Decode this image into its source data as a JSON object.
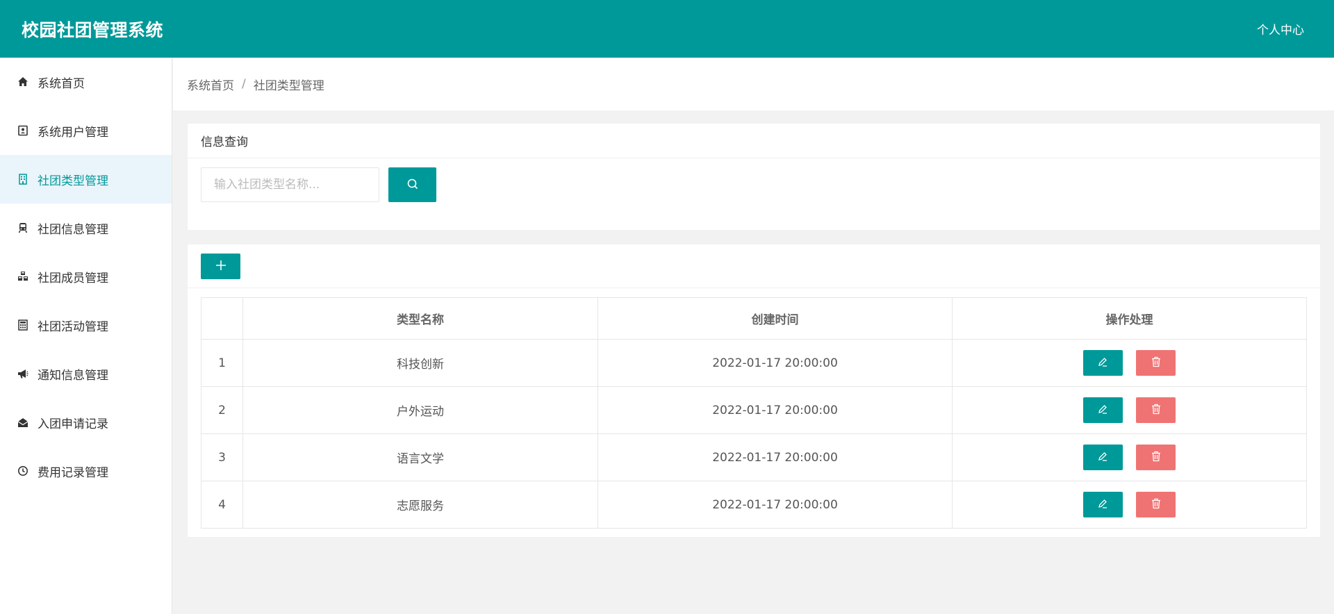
{
  "header": {
    "app_title": "校园社团管理系统",
    "user_center": "个人中心"
  },
  "sidebar": {
    "items": [
      {
        "label": "系统首页",
        "icon": "home-icon",
        "active": false
      },
      {
        "label": "系统用户管理",
        "icon": "user-card-icon",
        "active": false
      },
      {
        "label": "社团类型管理",
        "icon": "building-icon",
        "active": true
      },
      {
        "label": "社团信息管理",
        "icon": "train-icon",
        "active": false
      },
      {
        "label": "社团成员管理",
        "icon": "cubes-icon",
        "active": false
      },
      {
        "label": "社团活动管理",
        "icon": "calculator-icon",
        "active": false
      },
      {
        "label": "通知信息管理",
        "icon": "megaphone-icon",
        "active": false
      },
      {
        "label": "入团申请记录",
        "icon": "envelope-open-icon",
        "active": false
      },
      {
        "label": "费用记录管理",
        "icon": "clock-icon",
        "active": false
      }
    ]
  },
  "breadcrumb": {
    "home": "系统首页",
    "separator": "/",
    "current": "社团类型管理"
  },
  "search": {
    "title": "信息查询",
    "placeholder": "输入社团类型名称...",
    "value": ""
  },
  "table": {
    "headers": [
      "",
      "类型名称",
      "创建时间",
      "操作处理"
    ],
    "rows": [
      {
        "index": "1",
        "name": "科技创新",
        "created": "2022-01-17 20:00:00"
      },
      {
        "index": "2",
        "name": "户外运动",
        "created": "2022-01-17 20:00:00"
      },
      {
        "index": "3",
        "name": "语言文学",
        "created": "2022-01-17 20:00:00"
      },
      {
        "index": "4",
        "name": "志愿服务",
        "created": "2022-01-17 20:00:00"
      }
    ]
  },
  "colors": {
    "primary": "#009999",
    "danger": "#f07373",
    "active_bg": "#eaf4fb"
  }
}
